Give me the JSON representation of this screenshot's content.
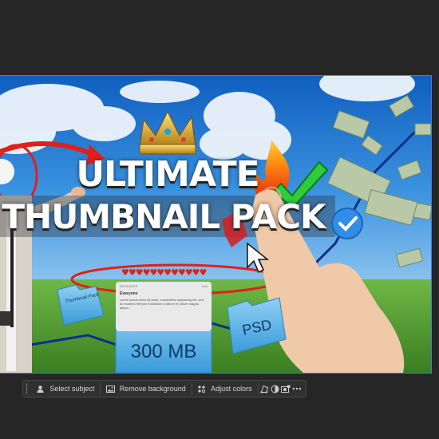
{
  "canvas": {
    "title_line_1": "ULTIMATE",
    "title_line_2": "THUMBNAIL PACK",
    "folder_left_label": "Thumbnail Pack",
    "folder_center_label": "300 MB",
    "folder_right_label": "PSD",
    "message_card": {
      "header": "MESSAGES",
      "time": "now",
      "title": "Everyone",
      "body": "Lorem ipsum dolor sit amet, consectetur adipiscing elit, sed do eiusmod tempor incididunt ut labore et dolore magna aliqua."
    },
    "hearts": "♥♥♥♥♥♥♥♥♥♥♥♥"
  },
  "toolbar": {
    "select_subject": "Select subject",
    "remove_background": "Remove background",
    "adjust_colors": "Adjust colors",
    "icons": [
      "person-icon",
      "image-icon",
      "palette-icon",
      "transform-icon",
      "contrast-icon",
      "mask-icon",
      "more-icon"
    ]
  },
  "colors": {
    "app_background": "#262626",
    "toolbar_background": "#303030",
    "canvas_outline": "#3f7fe0"
  }
}
